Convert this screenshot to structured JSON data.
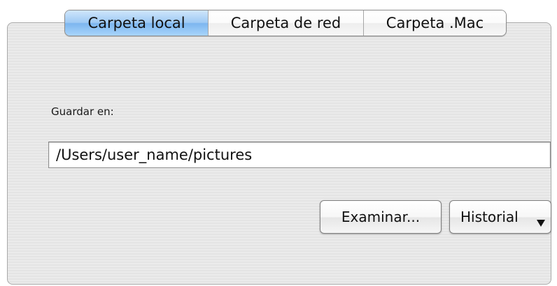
{
  "tabs": [
    {
      "label": "Carpeta local",
      "selected": true
    },
    {
      "label": "Carpeta de red",
      "selected": false
    },
    {
      "label": "Carpeta .Mac",
      "selected": false
    }
  ],
  "save_location": {
    "label": "Guardar en:",
    "path_value": "/Users/user_name/pictures"
  },
  "buttons": {
    "browse_label": "Examinar...",
    "history_label": "Historial",
    "history_icon": "dropdown-triangle-icon"
  },
  "colors": {
    "selected_tab": "#9fcaf4",
    "panel_background": "#e8e8e8"
  }
}
